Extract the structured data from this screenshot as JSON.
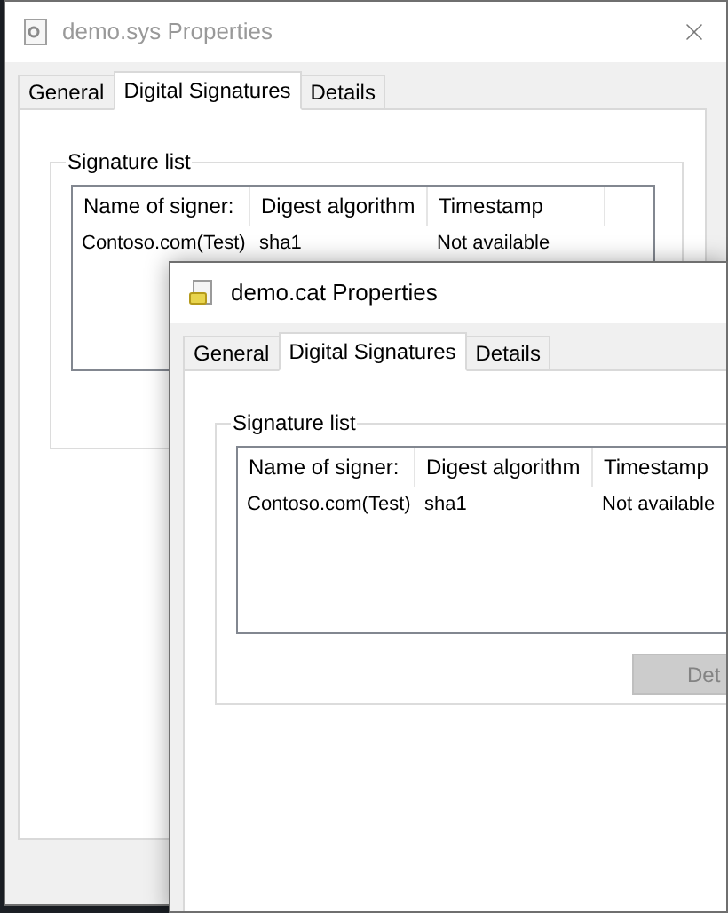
{
  "windows": [
    {
      "title": "demo.sys Properties",
      "active": false,
      "tabs": [
        {
          "label": "General",
          "selected": false
        },
        {
          "label": "Digital Signatures",
          "selected": true
        },
        {
          "label": "Details",
          "selected": false
        }
      ],
      "group_title": "Signature list",
      "columns": [
        "Name of signer:",
        "Digest algorithm",
        "Timestamp"
      ],
      "rows": [
        [
          "Contoso.com(Test)",
          "sha1",
          "Not available"
        ]
      ]
    },
    {
      "title": "demo.cat Properties",
      "active": true,
      "tabs": [
        {
          "label": "General",
          "selected": false
        },
        {
          "label": "Digital Signatures",
          "selected": true
        },
        {
          "label": "Details",
          "selected": false
        }
      ],
      "group_title": "Signature list",
      "columns": [
        "Name of signer:",
        "Digest algorithm",
        "Timestamp"
      ],
      "rows": [
        [
          "Contoso.com(Test)",
          "sha1",
          "Not available"
        ]
      ],
      "button": {
        "label": "Det",
        "disabled": true
      }
    }
  ]
}
